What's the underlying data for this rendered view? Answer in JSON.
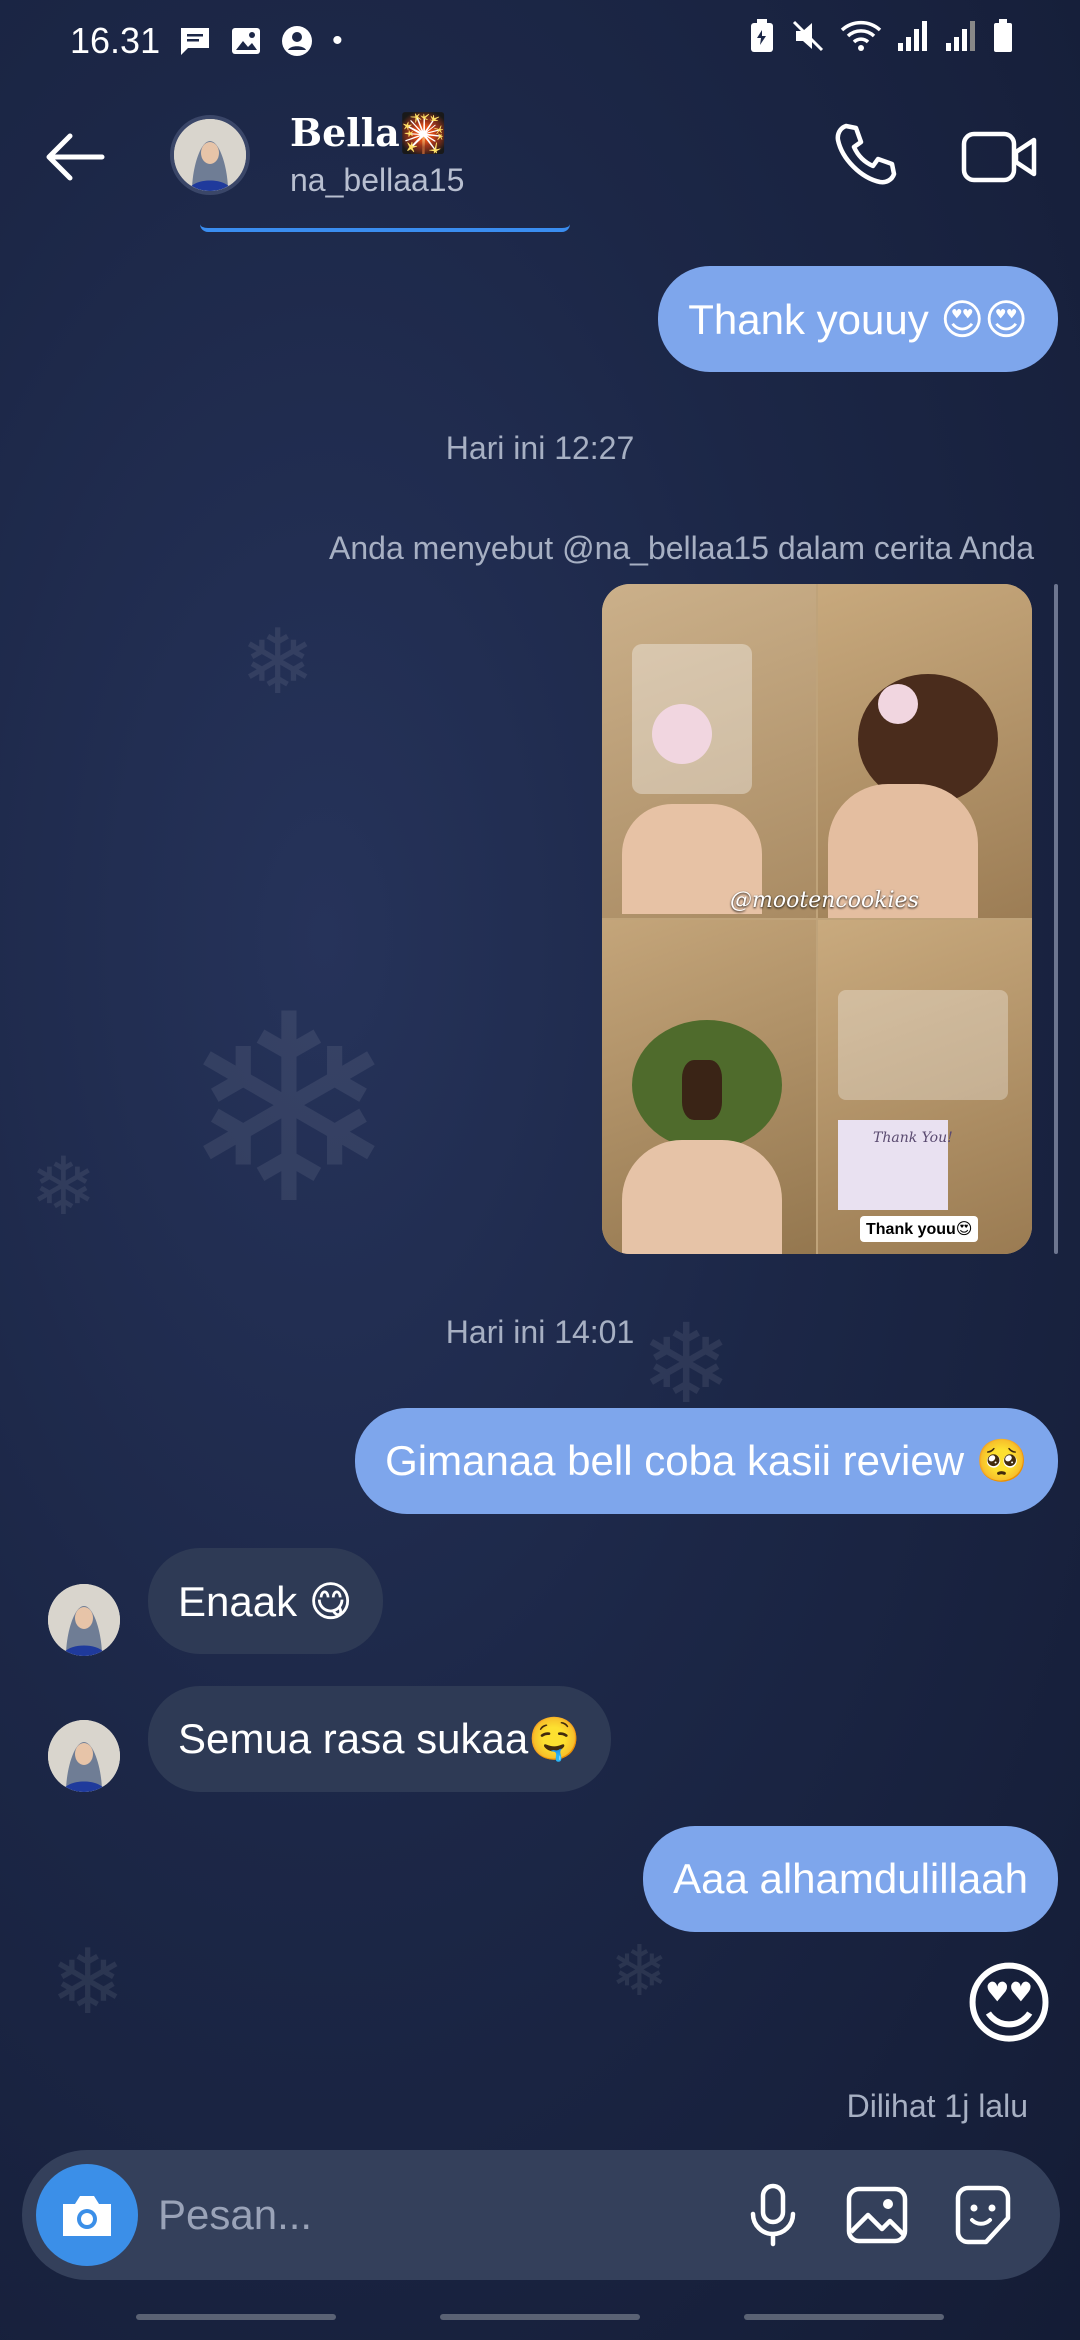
{
  "status_bar": {
    "time": "16.31",
    "dot": "•"
  },
  "header": {
    "name": "Bella🎇",
    "username": "na_bellaa15"
  },
  "messages": [
    {
      "type": "out",
      "text": "Thank youuy 😍😍"
    },
    {
      "type": "timestamp",
      "text": "Hari ini 12:27"
    },
    {
      "type": "story_mention",
      "text": "Anda menyebut @na_bellaa15 dalam cerita Anda"
    },
    {
      "type": "timestamp",
      "text": "Hari ini 14:01"
    },
    {
      "type": "out",
      "text": "Gimanaa bell coba kasii review 🥺"
    },
    {
      "type": "in",
      "text": "Enaak 😋"
    },
    {
      "type": "in",
      "text": "Semua rasa sukaa🤤"
    },
    {
      "type": "out",
      "text": "Aaa alhamdulillaah"
    },
    {
      "type": "out_emoji",
      "text": "😍"
    }
  ],
  "story": {
    "watermark": "@mootencookies",
    "sticker": "Thank youu😍",
    "card_text": "Thank You!"
  },
  "seen_text": "Dilihat 1j lalu",
  "composer": {
    "placeholder": "Pesan..."
  },
  "colors": {
    "outgoing": "#7ea6ec",
    "incoming": "#2e3a55",
    "accent": "#3b8fe8"
  }
}
